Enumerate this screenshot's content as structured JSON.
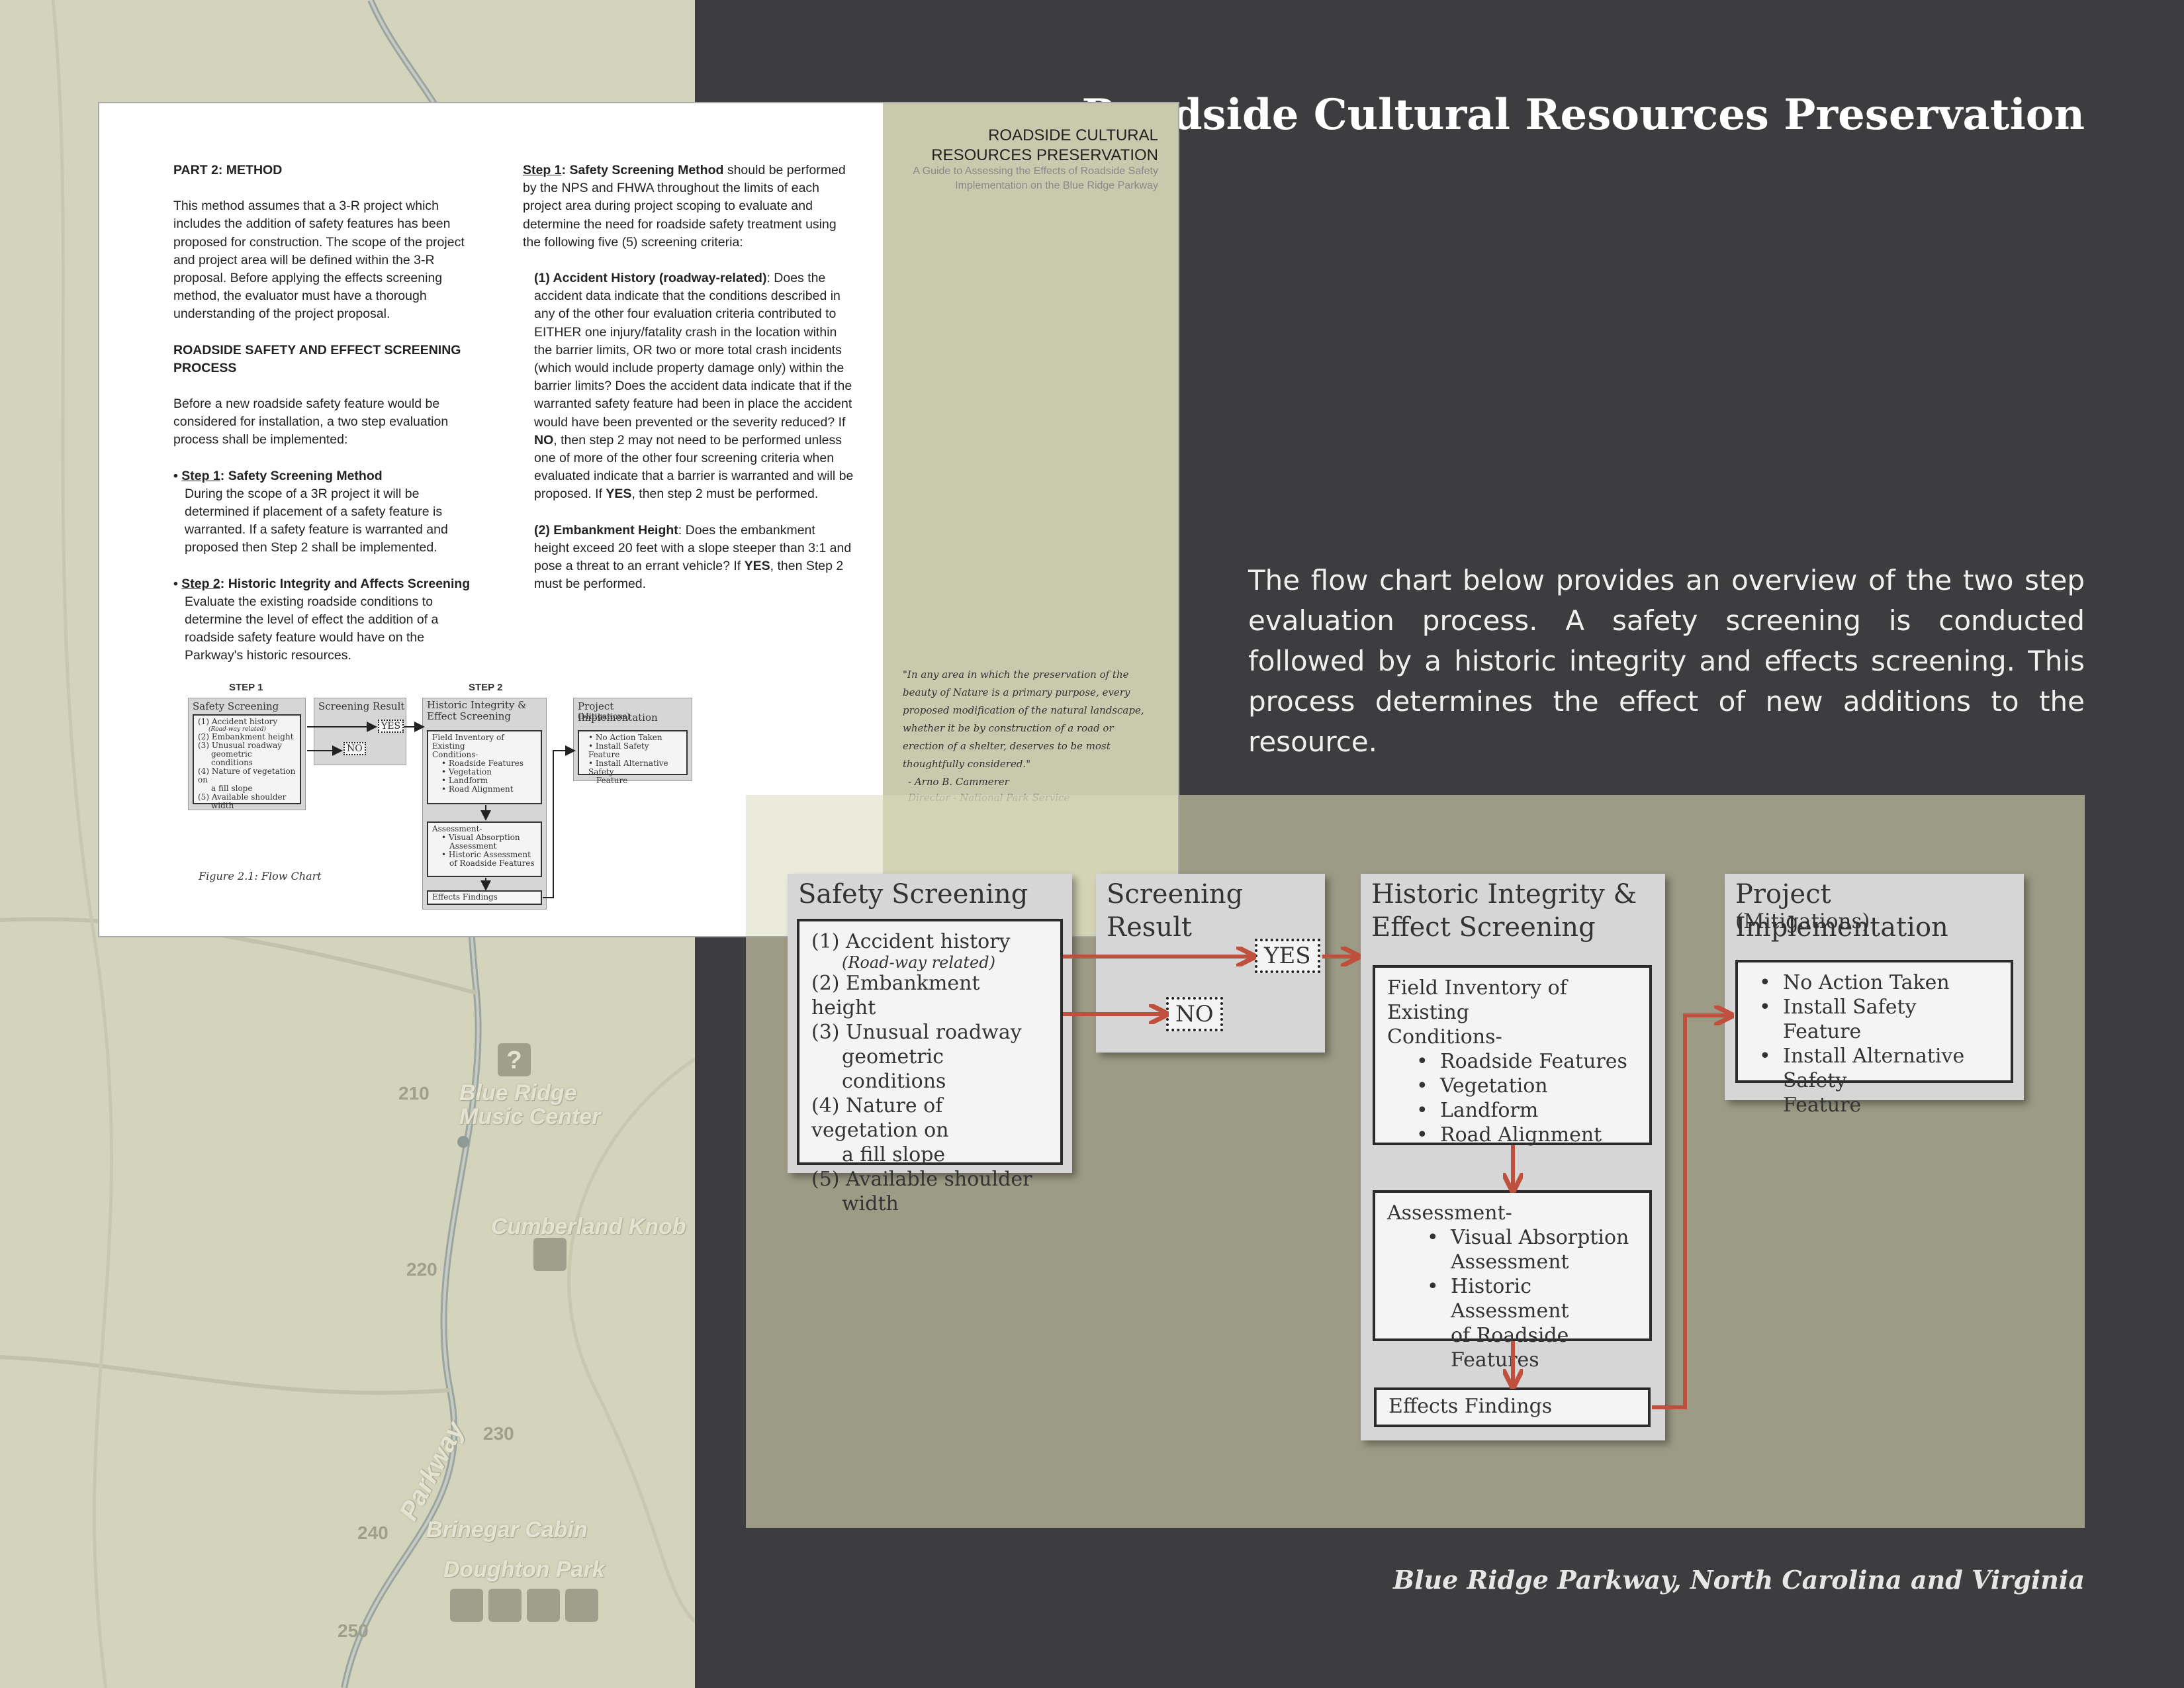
{
  "header": {
    "title": "Roadside Cultural Resources Preservation",
    "intro": "The flow chart below provides an overview of the two step evaluation process.  A safety screening is conducted followed by a historic integrity and effects screening. This process determines the effect of new additions to the resource.",
    "footer": "Blue Ridge Parkway, North Carolina and Virginia"
  },
  "map": {
    "labels": [
      "Blue Ridge",
      "Music Center",
      "Cumberland Knob",
      "Brinegar Cabin",
      "Doughton Park",
      "Parkway"
    ],
    "mileposts": [
      "210",
      "220",
      "230",
      "240",
      "250"
    ]
  },
  "document": {
    "heading": "PART 2: METHOD",
    "para1": "This method assumes that a 3-R project which includes the addition of safety features has been proposed for construction. The scope of the project and project area will be defined within the 3-R proposal. Before applying the effects screening method, the evaluator must have a thorough understanding of the project proposal.",
    "heading2": "ROADSIDE SAFETY AND EFFECT SCREENING PROCESS",
    "para2": "Before a new roadside safety feature would be considered for installation, a two step evaluation process shall be implemented:",
    "step1_label": "Step 1",
    "step1_title": ": Safety Screening Method",
    "step1_text": "During the scope of a 3R project it will be determined if placement of a safety feature is warranted. If a safety feature is warranted and proposed then Step 2 shall be implemented.",
    "step2_label": "Step 2",
    "step2_title": ": Historic Integrity and Affects Screening",
    "step2_text": "Evaluate the existing roadside conditions to determine the level of effect the addition of a roadside safety feature would have on the Parkway's historic resources.",
    "col2_label": "Step 1",
    "col2_title": ": Safety Screening Method",
    "col2_text": " should be performed by the NPS and FHWA throughout the limits of each project area during project scoping to evaluate and determine the need for roadside safety treatment using the following five (5) screening criteria:",
    "crit1_title": "(1) Accident History (roadway-related)",
    "crit1_a": ": Does the accident data indicate that the conditions described in any of the other four evaluation criteria contributed to EITHER one injury/fatality crash in the location within the barrier limits, OR two or more total crash incidents (which would include property damage only) within the barrier limits? Does the accident data indicate that if the warranted safety feature had been in place the accident would have been prevented or the severity reduced? If ",
    "crit1_no": "NO",
    "crit1_b": ", then step 2 may not need to be performed unless one of more of the other four screening criteria when evaluated indicate that a barrier is warranted and will be proposed. If ",
    "crit1_yes": "YES",
    "crit1_c": ", then step 2 must be performed.",
    "crit2_title": "(2) Embankment Height",
    "crit2_a": ": Does the embankment height exceed 20 feet with a slope steeper than 3:1 and pose a threat to an errant vehicle? If ",
    "crit2_yes": "YES",
    "crit2_b": ", then Step 2 must be performed.",
    "sidebar_title": "ROADSIDE CULTURAL RESOURCES PRESERVATION",
    "sidebar_subtitle": "A Guide to Assessing the Effects of Roadside Safety Implementation on the Blue Ridge Parkway",
    "quote": "\"In any area in which the preservation of the beauty of Nature is a primary purpose, every proposed modification of the natural landscape, whether it be by construction of a road or erection of a shelter, deserves to be most thoughtfully considered.\"",
    "quote_author": "- Arno B. Cammerer",
    "quote_author_title": "Director  -  National Park Service",
    "figure_caption": "Figure 2.1: Flow Chart",
    "step1_header": "STEP 1",
    "step2_header": "STEP 2"
  },
  "flowchart": {
    "safety": {
      "title": "Safety Screening",
      "items": [
        "(1) Accident history",
        "(Road-way related)",
        "(2) Embankment height",
        "(3) Unusual roadway",
        "geometric conditions",
        "(4) Nature of vegetation on",
        "a fill slope",
        "(5) Available shoulder",
        "width"
      ]
    },
    "result": {
      "title": "Screening Result",
      "yes": "YES",
      "no": "NO"
    },
    "historic": {
      "title1": "Historic Integrity &",
      "title2": "Effect Screening",
      "inventory_title1": "Field Inventory of Existing",
      "inventory_title2": "Conditions-",
      "inventory_items": [
        "Roadside Features",
        "Vegetation",
        "Landform",
        "Road Alignment"
      ],
      "assessment_title": "Assessment-",
      "assessment_items": [
        "Visual Absorption",
        "Assessment",
        "Historic Assessment",
        "of Roadside Features"
      ],
      "findings": "Effects Findings"
    },
    "project": {
      "title": "Project Implementation",
      "subtitle": "(Mitigations)",
      "items": [
        "No Action Taken",
        "Install Safety Feature",
        "Install Alternative Safety",
        "Feature"
      ]
    },
    "colors": {
      "arrow": "#c0503e",
      "panel": "#9c9b85",
      "box": "#d6d6d6"
    }
  }
}
